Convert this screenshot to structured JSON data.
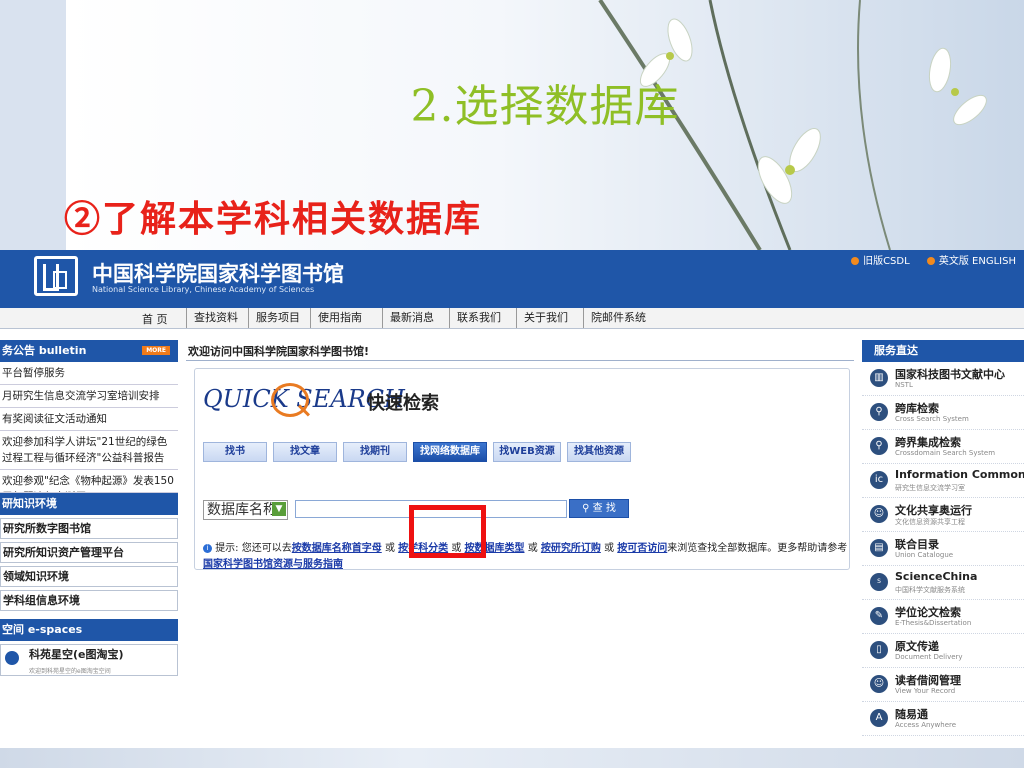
{
  "slide": {
    "title": "2.选择数据库",
    "subtitle": "②了解本学科相关数据库"
  },
  "site": {
    "name": "中国科学院国家科学图书馆",
    "name_en": "National Science Library, Chinese Academy of Sciences",
    "top_links": [
      "旧版CSDL",
      "英文版 ENGLISH"
    ]
  },
  "nav": {
    "home": "首 页",
    "items": [
      "查找资料",
      "服务项目",
      "使用指南",
      "最新消息",
      "联系我们",
      "关于我们",
      "院邮件系统"
    ]
  },
  "left": {
    "bulletin_title": "务公告 bulletin",
    "more": "MORE",
    "bulletin_items": [
      "平台暂停服务",
      "月研究生信息交流学习室培训安排",
      "有奖阅读征文活动通知",
      "欢迎参加科学人讲坛\"21世纪的绿色过程工程与循环经济\"公益科普报告",
      "欢迎参观\"纪念《物种起源》发表150周年暨达尔文诞辰200"
    ],
    "knowledge_title": "研知识环境",
    "knowledge_items": [
      "研究所数字图书馆",
      "研究所知识资产管理平台",
      "领域知识环境",
      "学科组信息环境"
    ],
    "espaces_title": "空间 e-spaces",
    "espace_item": "科苑星空(e图淘宝)",
    "espace_sub": "欢迎到科苑星空的e图淘宝空间"
  },
  "center": {
    "welcome": "欢迎访问中国科学院国家科学图书馆!",
    "quicksearch_logo": "QUICK SEARCH",
    "quicksearch_cn": "快速检索",
    "tabs": [
      "找书",
      "找文章",
      "找期刊",
      "找网络数据库",
      "找WEB资源",
      "找其他资源"
    ],
    "active_tab": "找网络数据库",
    "select_value": "数据库名称",
    "search_button": "查 找",
    "hint_prefix": "提示: 您还可以去",
    "hint_link1": "按数据库名称首字母",
    "hint_or": "或",
    "hint_link2": "按学科分类",
    "hint_link3": "按数据库类型",
    "hint_link4": "按研究所订购",
    "hint_link5": "按可否访问",
    "hint_tail": "来浏览查找全部数据库。更多帮助请参考",
    "hint_link6": "国家科学图书馆资源与服务指南"
  },
  "right": {
    "title": "服务直达",
    "items": [
      {
        "title": "国家科技图书文献中心",
        "sub": "NSTL"
      },
      {
        "title": "跨库检索",
        "sub": "Cross Search System"
      },
      {
        "title": "跨界集成检索",
        "sub": "Crossdomain Search System"
      },
      {
        "title": "Information Commons",
        "sub": "研究生信息交流学习室"
      },
      {
        "title": "文化共享奥运行",
        "sub": "文化信息资源共享工程"
      },
      {
        "title": "联合目录",
        "sub": "Union Catalogue"
      },
      {
        "title": "ScienceChina",
        "sub": "中国科学文献服务系统"
      },
      {
        "title": "学位论文检索",
        "sub": "E-Thesis&Dissertation"
      },
      {
        "title": "原文传递",
        "sub": "Document Delivery"
      },
      {
        "title": "读者借阅管理",
        "sub": "View Your Record"
      },
      {
        "title": "随易通",
        "sub": "Access Anywhere"
      }
    ]
  }
}
